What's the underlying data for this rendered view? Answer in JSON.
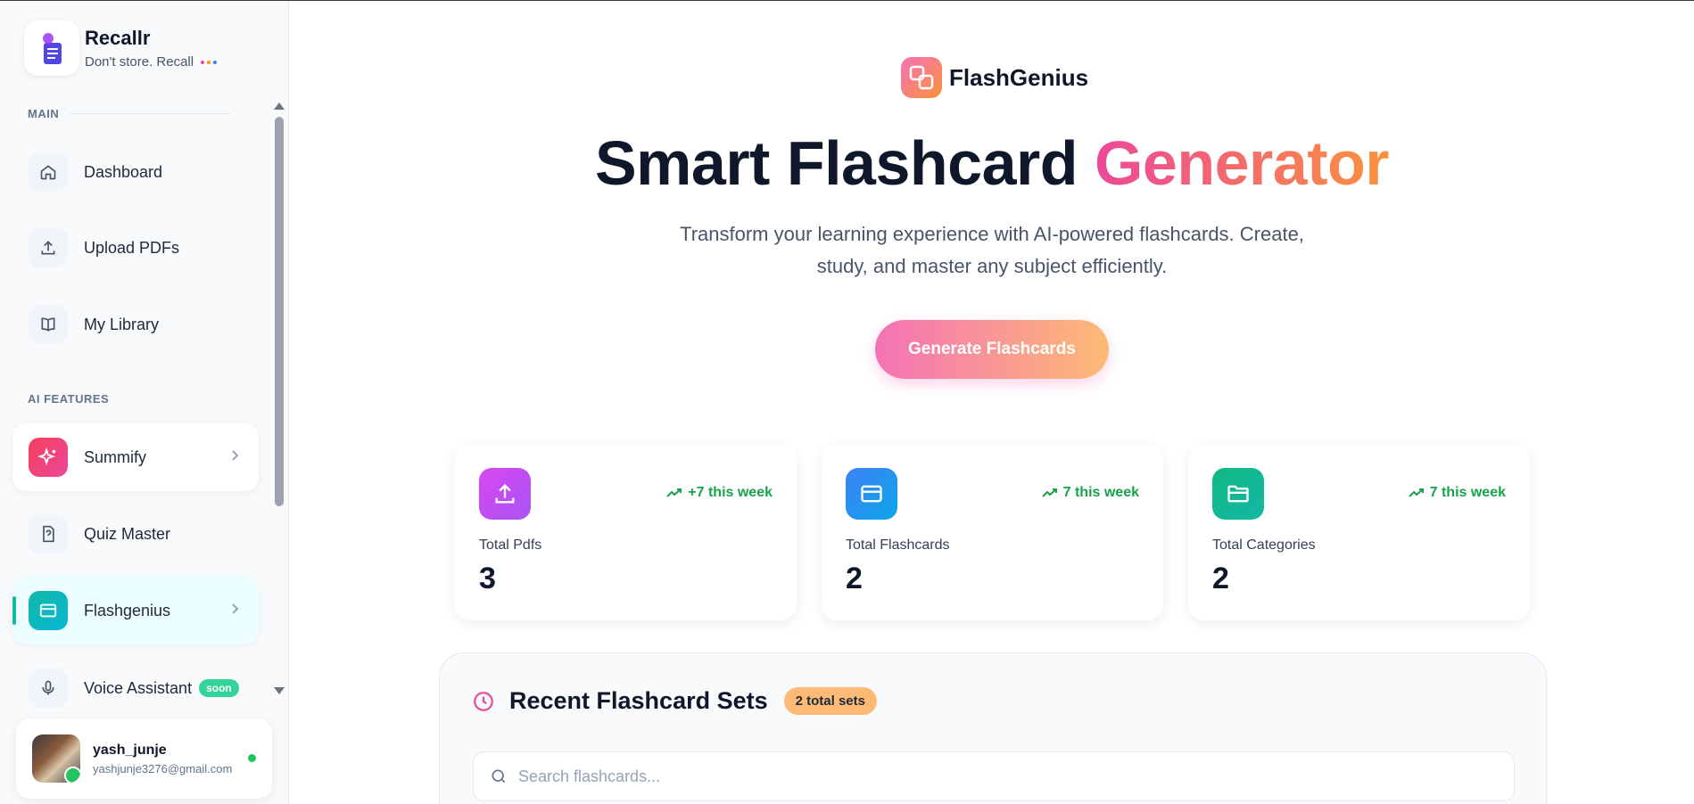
{
  "sidebar": {
    "brand": {
      "name": "Recallr",
      "tagline": "Don't store. Recall"
    },
    "sections": {
      "main": "MAIN",
      "ai": "AI FEATURES"
    },
    "items": [
      {
        "label": "Dashboard",
        "icon": "home-icon"
      },
      {
        "label": "Upload PDFs",
        "icon": "upload-icon"
      },
      {
        "label": "My Library",
        "icon": "book-icon"
      },
      {
        "label": "Summify",
        "icon": "sparkles-icon"
      },
      {
        "label": "Quiz Master",
        "icon": "quiz-icon"
      },
      {
        "label": "Flashgenius",
        "icon": "card-icon"
      },
      {
        "label": "Voice Assistant",
        "icon": "mic-icon",
        "badge": "soon"
      }
    ],
    "user": {
      "name": "yash_junje",
      "email": "yashjunje3276@gmail.com"
    }
  },
  "main": {
    "brand": "FlashGenius",
    "title_plain": "Smart Flashcard",
    "title_accent": "Generator",
    "subtitle": "Transform your learning experience with AI-powered flashcards. Create, study, and master any subject efficiently.",
    "cta": "Generate Flashcards",
    "stats": [
      {
        "label": "Total Pdfs",
        "value": "3",
        "trend": "+7 this week",
        "color": "#c026d3"
      },
      {
        "label": "Total Flashcards",
        "value": "2",
        "trend": "7 this week",
        "color": "#2563eb"
      },
      {
        "label": "Total Categories",
        "value": "2",
        "trend": "7 this week",
        "color": "#10b981"
      }
    ],
    "recent": {
      "title": "Recent Flashcard Sets",
      "count_badge": "2 total sets",
      "search_placeholder": "Search flashcards..."
    }
  },
  "colors": {
    "accent_pink": "#ec4899",
    "accent_orange": "#fb923c",
    "active_teal": "#14b8a6",
    "trend_green": "#16a34a"
  }
}
